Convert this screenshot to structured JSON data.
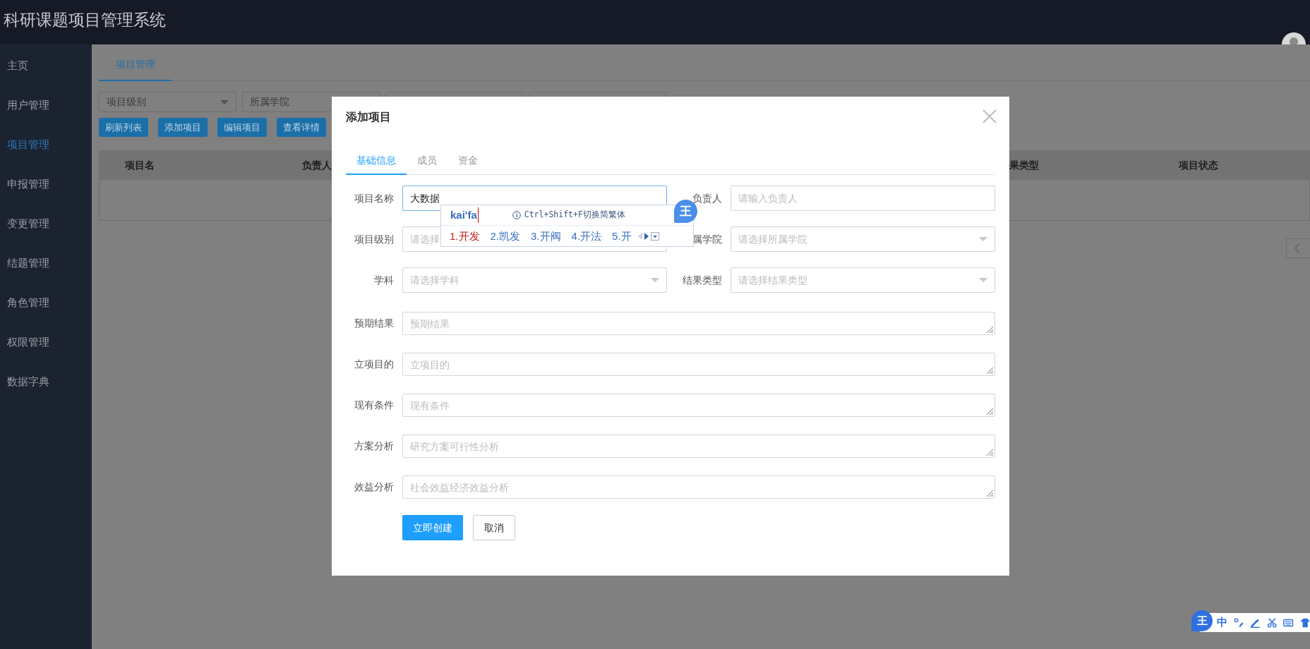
{
  "header": {
    "title": "科研课题项目管理系统"
  },
  "sidebar": {
    "items": [
      {
        "label": "主页",
        "selected": false
      },
      {
        "label": "用户管理",
        "selected": false
      },
      {
        "label": "项目管理",
        "selected": true
      },
      {
        "label": "申报管理",
        "selected": false
      },
      {
        "label": "变更管理",
        "selected": false
      },
      {
        "label": "结题管理",
        "selected": false
      },
      {
        "label": "角色管理",
        "selected": false
      },
      {
        "label": "权限管理",
        "selected": false
      },
      {
        "label": "数据字典",
        "selected": false
      }
    ]
  },
  "main": {
    "tabs": [
      {
        "label": "项目管理",
        "selected": true
      }
    ],
    "filters": [
      {
        "kind": "select",
        "placeholder": "项目级别"
      },
      {
        "kind": "select_partial",
        "placeholder": "所属学院"
      },
      {
        "kind": "select_partial"
      },
      {
        "kind": "select_partial"
      }
    ],
    "buttons": [
      "刷新列表",
      "添加项目",
      "编辑项目",
      "查看详情"
    ],
    "table": {
      "columns": [
        "项目名",
        "负责人",
        "果类型",
        "项目状态"
      ]
    }
  },
  "modal": {
    "title": "添加项目",
    "tabs": [
      {
        "label": "基础信息",
        "selected": true
      },
      {
        "label": "成员",
        "selected": false
      },
      {
        "label": "资金",
        "selected": false
      }
    ],
    "fields": [
      {
        "kind": "input",
        "label": "项目名称",
        "value": "大数据",
        "focused": true
      },
      {
        "kind": "input",
        "label": "负责人",
        "placeholder": "请输入负责人",
        "focused": false
      },
      {
        "kind": "select_partial",
        "label": "项目级别",
        "placeholder": "请选择",
        "focused": false
      },
      {
        "kind": "select",
        "label": "属学院",
        "placeholder": "请选择所属学院",
        "focused": false
      },
      {
        "kind": "select",
        "label": "学科",
        "placeholder": "请选择学科",
        "focused": false
      },
      {
        "kind": "select",
        "label": "结果类型",
        "placeholder": "请选择结果类型",
        "focused": false
      },
      {
        "kind": "textarea",
        "label": "预期结果",
        "placeholder": "预期结果",
        "focused": false
      },
      {
        "kind": "textarea",
        "label": "立项目的",
        "placeholder": "立项目的",
        "focused": false
      },
      {
        "kind": "textarea",
        "label": "现有条件",
        "placeholder": "现有条件",
        "focused": false
      },
      {
        "kind": "textarea",
        "label": "方案分析",
        "placeholder": "研究方案可行性分析",
        "focused": false
      },
      {
        "kind": "textarea",
        "label": "效益分析",
        "placeholder": "社会效益经济效益分析",
        "focused": false
      }
    ],
    "buttons": [
      {
        "label": "立即创建",
        "kind": "primary"
      },
      {
        "label": "取消",
        "kind": "default"
      }
    ]
  },
  "ime": {
    "composition": "kai'fa",
    "hint": "Ctrl+Shift+F切换简繁体",
    "badge": "王",
    "candidates": [
      {
        "label": "1.开发",
        "selected": true
      },
      {
        "label": "2.凯发",
        "selected": false
      },
      {
        "label": "3.开阀",
        "selected": false
      },
      {
        "label": "4.开法",
        "selected": false
      },
      {
        "label": "5.开",
        "selected": false
      }
    ]
  },
  "ime_toolbar": {
    "badge": "王",
    "mode": "中"
  }
}
